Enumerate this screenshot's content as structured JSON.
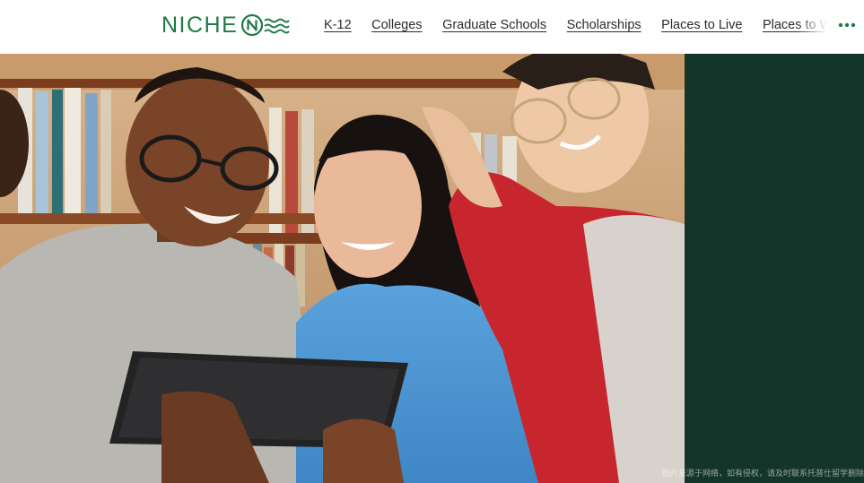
{
  "header": {
    "logo": {
      "text": "NICHE",
      "mark_icon": "niche-n-waves-icon"
    },
    "nav_items": [
      {
        "label": "K-12"
      },
      {
        "label": "Colleges"
      },
      {
        "label": "Graduate Schools"
      },
      {
        "label": "Scholarships"
      },
      {
        "label": "Places to Live"
      },
      {
        "label": "Places to Work"
      }
    ],
    "more_icon": "ellipsis-icon"
  },
  "hero": {
    "image": "three-students-looking-at-tablet-in-library-photo"
  },
  "side_panel": {
    "watermark": "图片来源于网络，如有侵权，请及时联系托普仕留学删除"
  },
  "colors": {
    "brand_green": "#1f7a44",
    "side_panel": "#14352a",
    "nav_text": "#2b2b2b"
  }
}
